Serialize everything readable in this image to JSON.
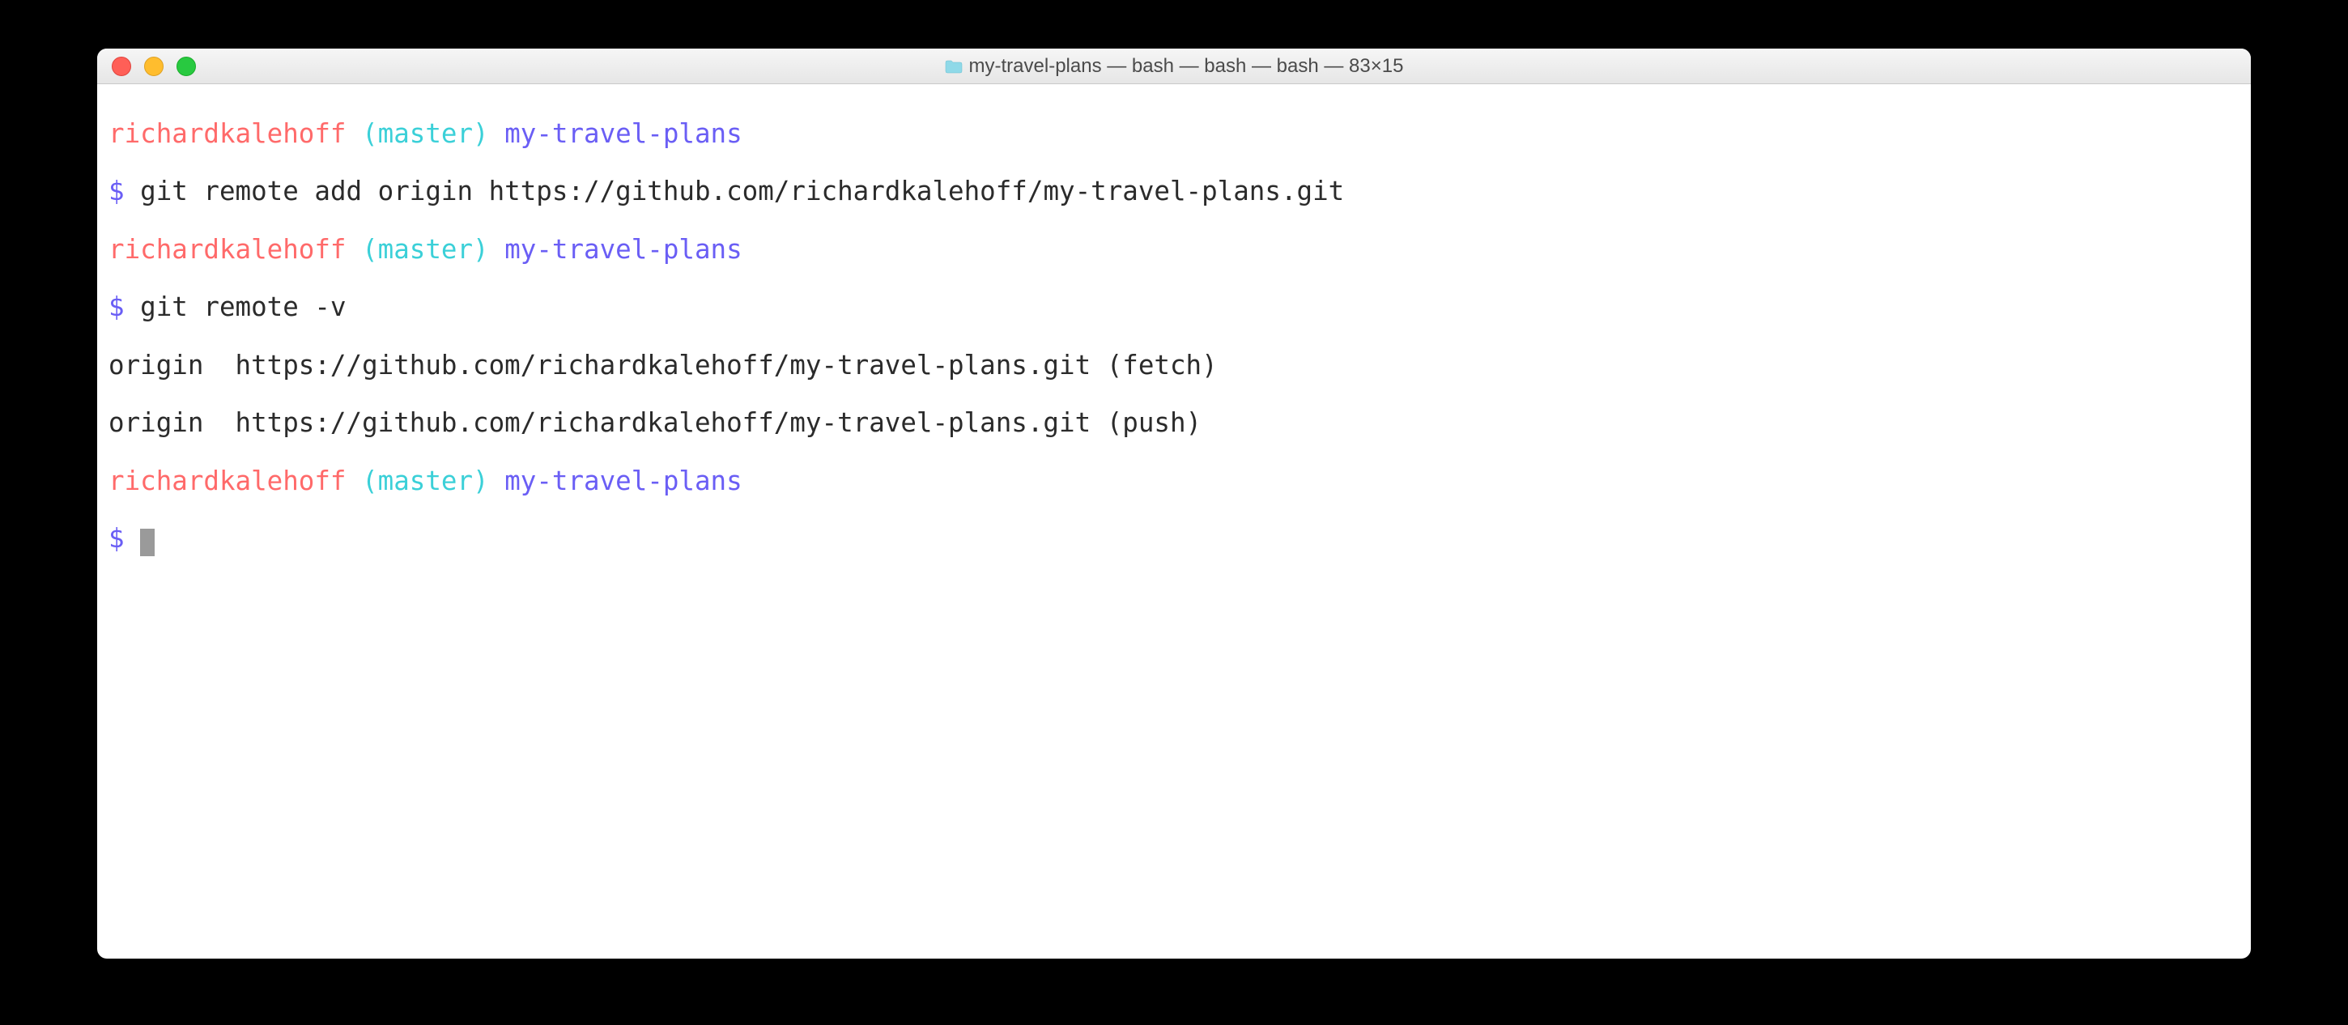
{
  "titlebar": {
    "title": "my-travel-plans — bash — bash — bash — 83×15"
  },
  "colors": {
    "user": "#ff6a6a",
    "paren": "#3bd0d8",
    "dir": "#6a5ef5",
    "prompt": "#6a5ef5"
  },
  "prompt": {
    "user": "richardkalehoff",
    "open_paren": " (",
    "branch": "master",
    "close_paren": ") ",
    "dir": "my-travel-plans",
    "symbol": "$ "
  },
  "lines": {
    "cmd1": "git remote add origin https://github.com/richardkalehoff/my-travel-plans.git",
    "cmd2": "git remote -v",
    "out1": "origin  https://github.com/richardkalehoff/my-travel-plans.git (fetch)",
    "out2": "origin  https://github.com/richardkalehoff/my-travel-plans.git (push)"
  }
}
